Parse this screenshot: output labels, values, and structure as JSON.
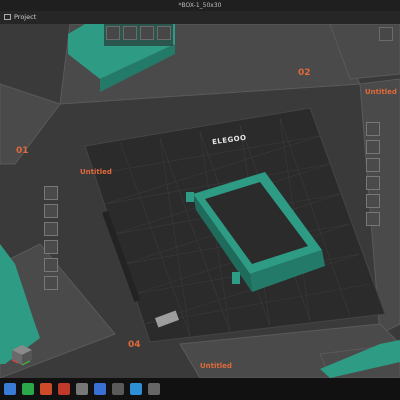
{
  "window": {
    "title": "*BOX-1_50x30"
  },
  "menu": {
    "project_label": "Project"
  },
  "plates": {
    "num_02": "02",
    "num_01": "01",
    "num_04": "04",
    "untitled_main": "Untitled",
    "untitled_bottom": "Untitled",
    "untitled_topright": "Untitled"
  },
  "brand": {
    "logo": "ELEGOO"
  },
  "colors": {
    "model": "#2e9c84",
    "plate": "#2b2b2b",
    "accent": "#e06a3b",
    "background": "#3a3a3a"
  },
  "toolbar_icons": [
    "cube-icon",
    "layers-icon",
    "paint-icon",
    "box-icon",
    "rectangle-icon",
    "grid-icon",
    "shape-icon",
    "shape-icon",
    "shape-icon",
    "shape-icon",
    "shape-icon",
    "shape-icon",
    "shape-icon",
    "text-icon"
  ],
  "left_panel_icons": [
    "close-icon",
    "fill-icon",
    "add-plate-icon",
    "rotate-icon",
    "arrange-icon",
    "orient-icon"
  ],
  "right_panel_icons": [
    "close-icon",
    "fill-icon",
    "add-plate-icon",
    "rotate-icon",
    "arrange-icon",
    "orient-icon"
  ]
}
